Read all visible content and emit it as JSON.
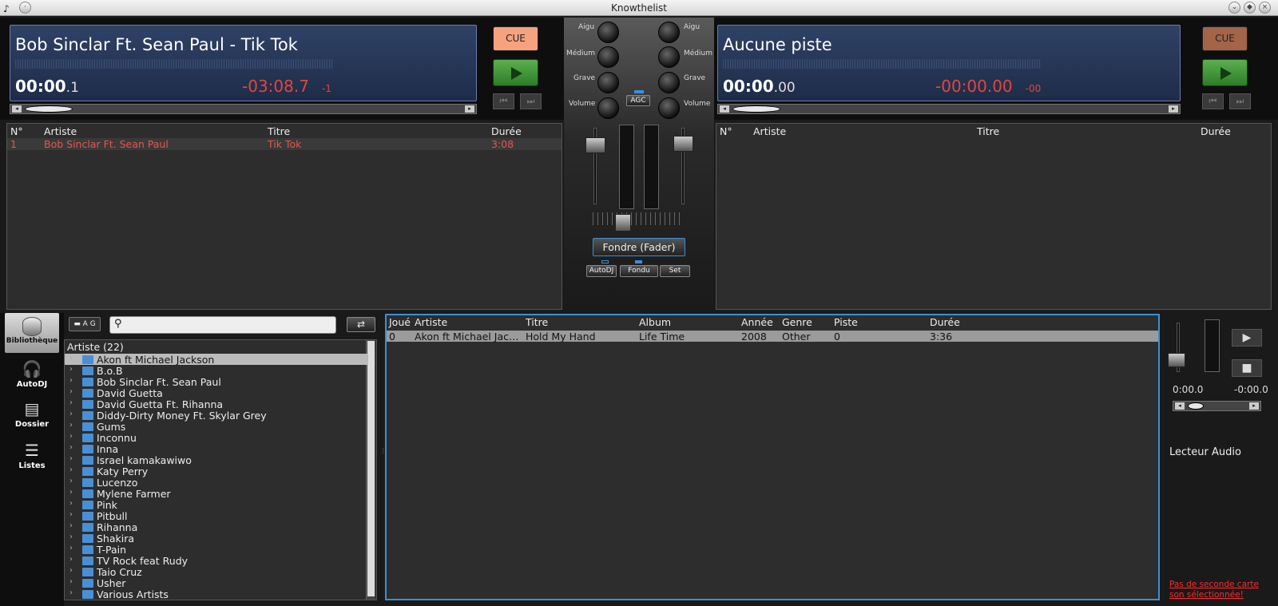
{
  "window": {
    "title": "Knowthelist"
  },
  "deck_left": {
    "track": "Bob Sinclar Ft. Sean Paul - Tik Tok",
    "elapsed_main": "00:00",
    "elapsed_frac": ".1",
    "remaining": "-03:08.7",
    "remaining_small": "-1",
    "cue": "CUE",
    "cue_color": "#f7a27e",
    "position": 0.0
  },
  "deck_right": {
    "track": "Aucune piste",
    "elapsed_main": "00:00",
    "elapsed_frac": ".00",
    "remaining": "-00:00.00",
    "remaining_small": "-00",
    "cue": "CUE",
    "cue_color": "#a36448",
    "position": 0.0
  },
  "playlist_headers": {
    "no": "N°",
    "artist": "Artiste",
    "title": "Titre",
    "duration": "Durée"
  },
  "playlist_left": [
    {
      "no": "1",
      "artist": "Bob Sinclar Ft. Sean Paul",
      "title": "Tik Tok",
      "duration": "3:08"
    }
  ],
  "mixer": {
    "aigu": "Aigu",
    "medium": "Médium",
    "grave": "Grave",
    "volume": "Volume",
    "agc": "AGC",
    "fader": "Fondre (Fader)",
    "autodj": "AutoDJ",
    "fondu": "Fondu",
    "set": "Set"
  },
  "sidebar": [
    {
      "label": "Bibliothèque",
      "icon": "database-icon"
    },
    {
      "label": "AutoDJ",
      "icon": "headphones-icon"
    },
    {
      "label": "Dossier",
      "icon": "folder-icon"
    },
    {
      "label": "Listes",
      "icon": "list-icon"
    }
  ],
  "search": {
    "placeholder": ""
  },
  "tree": {
    "header": "Artiste  (22)",
    "items": [
      "Akon ft Michael Jackson",
      "B.o.B",
      "Bob Sinclar Ft. Sean Paul",
      "David Guetta",
      "David Guetta Ft. Rihanna",
      "Diddy-Dirty Money Ft. Skylar Grey",
      "Gums",
      "Inconnu",
      "Inna",
      "Israel kamakawiwo",
      "Katy Perry",
      "Lucenzo",
      "Mylene Farmer",
      "Pink",
      "Pitbull",
      "Rihanna",
      "Shakira",
      "T-Pain",
      "TV Rock feat Rudy",
      "Taio Cruz",
      "Usher",
      "Various Artists"
    ]
  },
  "library": {
    "headers": [
      "Joué",
      "Artiste",
      "Titre",
      "Album",
      "Année",
      "Genre",
      "Piste",
      "Durée"
    ],
    "rows": [
      [
        "0",
        "Akon ft Michael Jac…",
        "Hold My Hand",
        "Life Time",
        "2008",
        "Other",
        "0",
        "3:36"
      ]
    ]
  },
  "preview": {
    "elapsed": "0:00.0",
    "remaining": "-0:00.0",
    "label": "Lecteur Audio",
    "warning": "Pas de seconde carte son sélectionnée!"
  }
}
